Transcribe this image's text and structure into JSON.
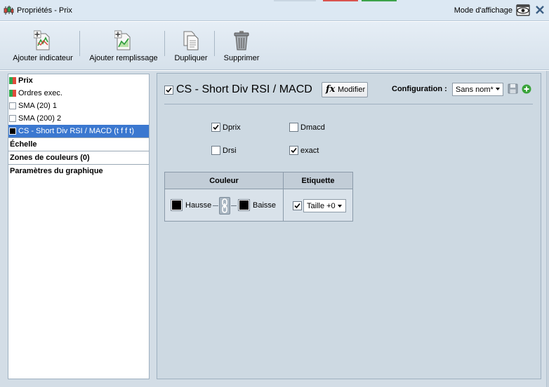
{
  "window": {
    "title": "Propriétés - Prix",
    "mode_label": "Mode d'affichage"
  },
  "toolbar": {
    "add_indicator": "Ajouter indicateur",
    "add_fill": "Ajouter remplissage",
    "duplicate": "Dupliquer",
    "delete": "Supprimer"
  },
  "sidebar": {
    "items": [
      {
        "label": "Prix",
        "swatch": "bicolor"
      },
      {
        "label": "Ordres exec.",
        "swatch": "bicolor"
      },
      {
        "label": "SMA (20) 1",
        "swatch": "empty"
      },
      {
        "label": "SMA (200) 2",
        "swatch": "empty"
      },
      {
        "label": "CS - Short Div RSI / MACD (t f f t)",
        "swatch": "black",
        "selected": true
      }
    ],
    "sections": [
      "Échelle",
      "Zones de couleurs (0)",
      "Paramètres du graphique"
    ]
  },
  "panel": {
    "title": "CS - Short Div RSI / MACD",
    "title_checked": true,
    "modify_label": "Modifier",
    "config_label": "Configuration :",
    "config_value": "Sans nom*",
    "options": [
      {
        "label": "Dprix",
        "checked": true
      },
      {
        "label": "Dmacd",
        "checked": false
      },
      {
        "label": "Drsi",
        "checked": false
      },
      {
        "label": "exact",
        "checked": true
      }
    ],
    "table": {
      "col_color": "Couleur",
      "col_label": "Etiquette",
      "up_label": "Hausse",
      "down_label": "Baisse",
      "up_color": "#000000",
      "down_color": "#000000",
      "label_checked": true,
      "size_value": "Taille +0"
    }
  },
  "colors": {
    "selection": "#3b78d0",
    "bull": "#2fa84f",
    "bear": "#e04b3c",
    "add": "#3aa43a"
  }
}
